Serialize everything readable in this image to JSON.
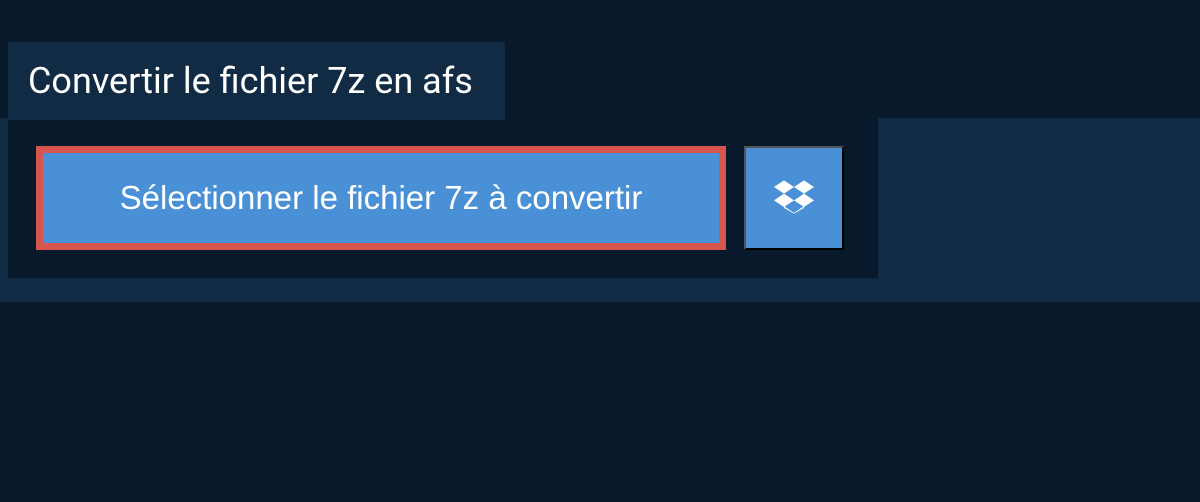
{
  "header": {
    "title": "Convertir le fichier 7z en afs"
  },
  "actions": {
    "select_file_label": "Sélectionner le fichier 7z à convertir"
  },
  "colors": {
    "background_dark": "#07192b",
    "background_mid": "#122b44",
    "button_blue": "#4990d6",
    "highlight_border": "#d6554f"
  }
}
